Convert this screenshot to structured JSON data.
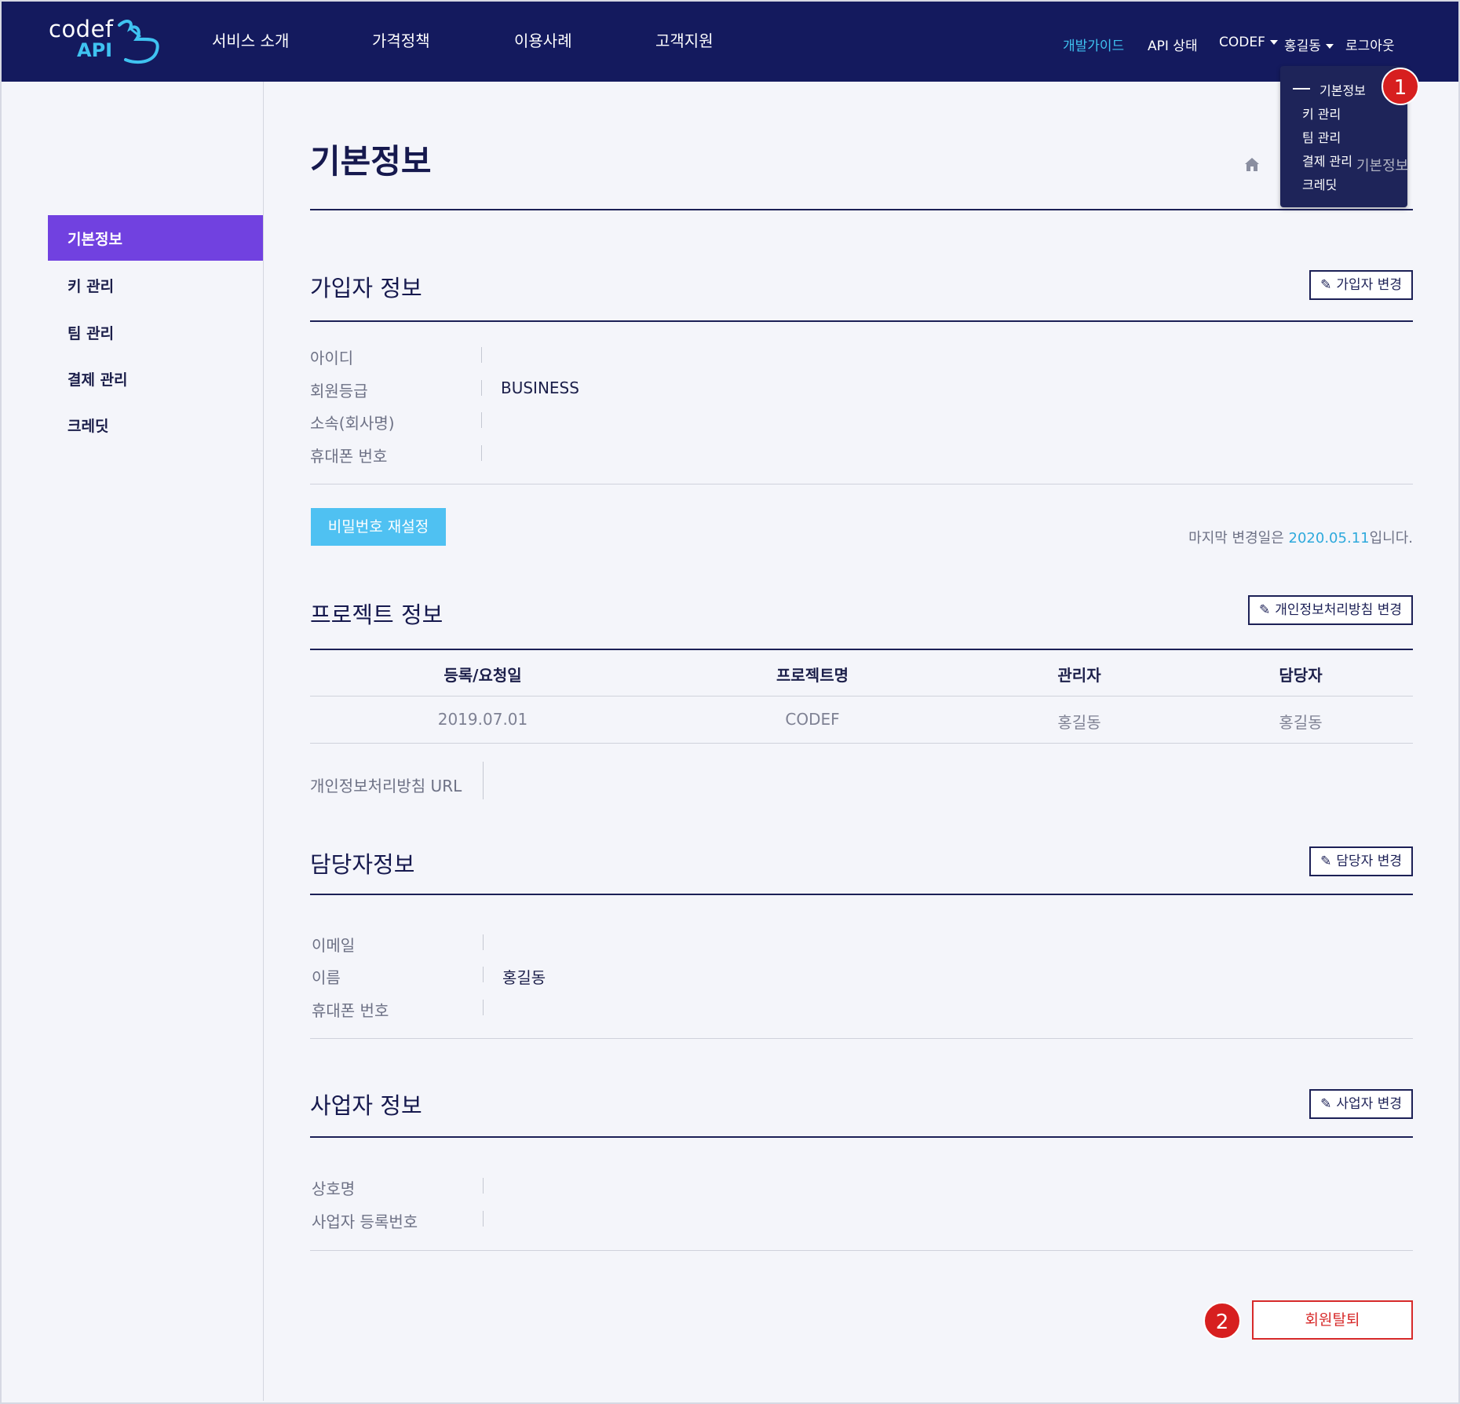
{
  "header": {
    "logo_top": "codef",
    "logo_bottom": "API",
    "nav": [
      "서비스 소개",
      "가격정책",
      "이용사례",
      "고객지원"
    ],
    "dev_guide": "개발가이드",
    "api_status": "API 상태",
    "codef_menu": "CODEF",
    "user_menu": "홍길동",
    "logout": "로그아웃"
  },
  "dropdown": {
    "items": [
      "기본정보",
      "키 관리",
      "팀 관리",
      "결제 관리",
      "크레딧"
    ],
    "marker": "1"
  },
  "sidebar": {
    "items": [
      "기본정보",
      "키 관리",
      "팀 관리",
      "결제 관리",
      "크레딧"
    ],
    "active": "기본정보"
  },
  "page": {
    "title": "기본정보",
    "breadcrumb": "기본정보"
  },
  "member": {
    "title": "가입자 정보",
    "edit_button": "가입자 변경",
    "fields": [
      {
        "label": "아이디",
        "value": ""
      },
      {
        "label": "회원등급",
        "value": "BUSINESS"
      },
      {
        "label": "소속(회사명)",
        "value": ""
      },
      {
        "label": "휴대폰 번호",
        "value": ""
      }
    ],
    "password_reset_button": "비밀번호 재설정",
    "last_modified_prefix": "마지막 변경일은 ",
    "last_modified_date": "2020.05.11",
    "last_modified_suffix": "입니다."
  },
  "project": {
    "title": "프로젝트 정보",
    "edit_button": "개인정보처리방침 변경",
    "columns": [
      "등록/요청일",
      "프로젝트명",
      "관리자",
      "담당자"
    ],
    "rows": [
      [
        "2019.07.01",
        "CODEF",
        "홍길동",
        "홍길동"
      ]
    ],
    "privacy_url_label": "개인정보처리방침 URL",
    "privacy_url_value": ""
  },
  "manager": {
    "title": "담당자정보",
    "edit_button": "담당자 변경",
    "fields": [
      {
        "label": "이메일",
        "value": ""
      },
      {
        "label": "이름",
        "value": "홍길동"
      },
      {
        "label": "휴대폰 번호",
        "value": ""
      }
    ]
  },
  "business": {
    "title": "사업자 정보",
    "edit_button": "사업자 변경",
    "fields": [
      {
        "label": "상호명",
        "value": ""
      },
      {
        "label": "사업자 등록번호",
        "value": ""
      }
    ]
  },
  "withdraw_button": "회원탈퇴",
  "withdraw_marker": "2",
  "colors": {
    "header_bg": "#141a5e",
    "accent_cyan": "#3fc3f1",
    "active_purple": "#7141e0",
    "danger_red": "#d72a2a",
    "marker_red": "#d71f1f"
  }
}
